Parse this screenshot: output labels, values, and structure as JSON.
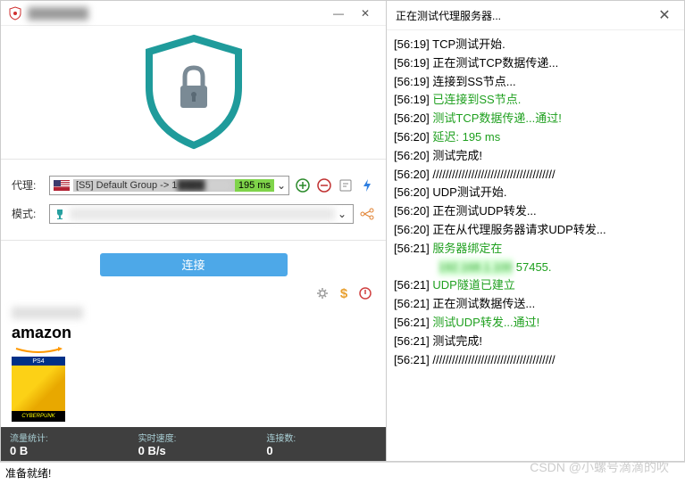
{
  "window": {
    "title_blurred": "████████",
    "minimize": "—",
    "close": "✕"
  },
  "right_panel": {
    "title": "正在测试代理服务器...",
    "close": "✕"
  },
  "form": {
    "proxy_label": "代理:",
    "proxy_text": "[S5] Default Group -> 1",
    "latency": "195 ms",
    "mode_label": "模式:",
    "connect_btn": "连接"
  },
  "icons": {
    "add": "add-icon",
    "remove": "remove-icon",
    "edit": "edit-icon",
    "bolt": "bolt-icon",
    "gear": "gear-icon",
    "dollar": "dollar-icon",
    "power": "power-icon",
    "network": "network-icon"
  },
  "amazon": {
    "logo": "amazon",
    "ps4": "PS4",
    "game": "CYBERPUNK"
  },
  "stats": {
    "traffic_label": "流量统计:",
    "traffic_value": "0 B",
    "speed_label": "实时速度:",
    "speed_value": "0 B/s",
    "conn_label": "连接数:",
    "conn_value": "0"
  },
  "status_footer": "准备就绪!",
  "log": [
    {
      "ts": "[56:19]",
      "text": "TCP测试开始.",
      "cls": "log-normal"
    },
    {
      "ts": "[56:19]",
      "text": "正在测试TCP数据传递...",
      "cls": "log-normal"
    },
    {
      "ts": "[56:19]",
      "text": "连接到SS节点...",
      "cls": "log-normal"
    },
    {
      "ts": "[56:19]",
      "text": "已连接到SS节点.",
      "cls": "log-green"
    },
    {
      "ts": "[56:20]",
      "text": "测试TCP数据传递...通过!",
      "cls": "log-green"
    },
    {
      "ts": "[56:20]",
      "text": "延迟: 195 ms",
      "cls": "log-green"
    },
    {
      "ts": "[56:20]",
      "text": "测试完成!",
      "cls": "log-normal"
    },
    {
      "ts": "[56:20]",
      "text": "//////////////////////////////////////",
      "cls": "log-normal"
    },
    {
      "ts": "[56:20]",
      "text": "UDP测试开始.",
      "cls": "log-normal"
    },
    {
      "ts": "[56:20]",
      "text": "正在测试UDP转发...",
      "cls": "log-normal"
    },
    {
      "ts": "[56:20]",
      "text": "正在从代理服务器请求UDP转发...",
      "cls": "log-normal"
    },
    {
      "ts": "[56:21]",
      "text": "服务器绑定在",
      "cls": "log-green"
    },
    {
      "ts": "",
      "text": "████████ 57455.",
      "cls": "log-green"
    },
    {
      "ts": "[56:21]",
      "text": "UDP隧道已建立",
      "cls": "log-green"
    },
    {
      "ts": "[56:21]",
      "text": "正在测试数据传送...",
      "cls": "log-normal"
    },
    {
      "ts": "[56:21]",
      "text": "测试UDP转发...通过!",
      "cls": "log-green"
    },
    {
      "ts": "[56:21]",
      "text": "测试完成!",
      "cls": "log-normal"
    },
    {
      "ts": "[56:21]",
      "text": "//////////////////////////////////////",
      "cls": "log-normal"
    }
  ],
  "watermark": "CSDN @小螺号滴滴的吹"
}
